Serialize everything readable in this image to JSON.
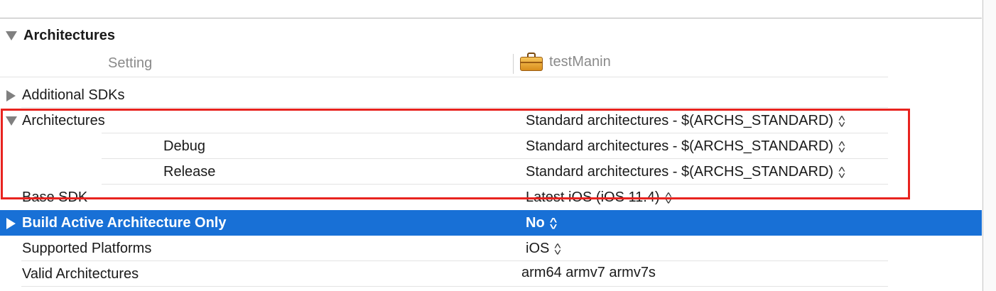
{
  "section": {
    "title": "Architectures"
  },
  "columns": {
    "setting": "Setting",
    "target": "testManin"
  },
  "rows": [
    {
      "label": "Additional SDKs",
      "value": ""
    },
    {
      "label": "Architectures",
      "value": "Standard architectures  -  $(ARCHS_STANDARD)"
    },
    {
      "label": "Debug",
      "value": "Standard architectures  -  $(ARCHS_STANDARD)"
    },
    {
      "label": "Release",
      "value": "Standard architectures  -  $(ARCHS_STANDARD)"
    },
    {
      "label": "Base SDK",
      "value": "Latest iOS (iOS 11.4)"
    },
    {
      "label": "Build Active Architecture Only",
      "value": "No"
    },
    {
      "label": "Supported Platforms",
      "value": "iOS"
    },
    {
      "label": "Valid Architectures",
      "value": "arm64 armv7 armv7s"
    }
  ],
  "colors": {
    "selection": "#1870d6",
    "annotation_box": "#e8231f"
  },
  "icons": {
    "target": "briefcase-icon",
    "stepper": "up-down-stepper-icon"
  }
}
